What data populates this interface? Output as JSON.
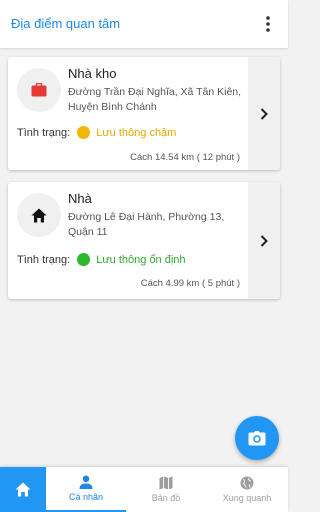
{
  "header": {
    "title": "Địa điểm quan tâm",
    "more_icon": "more-vert-icon"
  },
  "places": [
    {
      "name": "Nhà kho",
      "icon": "briefcase-icon",
      "icon_color": "#e53935",
      "address": "Đường Trần Đại Nghĩa, Xã Tân Kiên, Huyện Bình Chánh",
      "status_label": "Tình trạng:",
      "status_text": "Lưu thông chậm",
      "status_color": "#f2b705",
      "status_text_color": "#e6a700",
      "distance": "Cách 14.54 km ( 12 phút )"
    },
    {
      "name": "Nhà",
      "icon": "home-icon",
      "icon_color": "#111111",
      "address": "Đường Lê Đại Hành, Phường 13, Quận 11",
      "status_label": "Tình trạng:",
      "status_text": "Lưu thông ổn định",
      "status_color": "#2eb82e",
      "status_text_color": "#2ea82e",
      "distance": "Cách 4.99 km ( 5 phút )"
    }
  ],
  "fab": {
    "icon": "camera-icon"
  },
  "bottom_nav": {
    "home_icon": "home-icon",
    "tabs": [
      {
        "label": "Cá nhân",
        "icon": "person-icon",
        "active": true
      },
      {
        "label": "Bản đồ",
        "icon": "map-icon",
        "active": false
      },
      {
        "label": "Xung quanh",
        "icon": "globe-icon",
        "active": false
      }
    ]
  },
  "colors": {
    "accent": "#2196f3",
    "background": "#f2f2f2"
  }
}
